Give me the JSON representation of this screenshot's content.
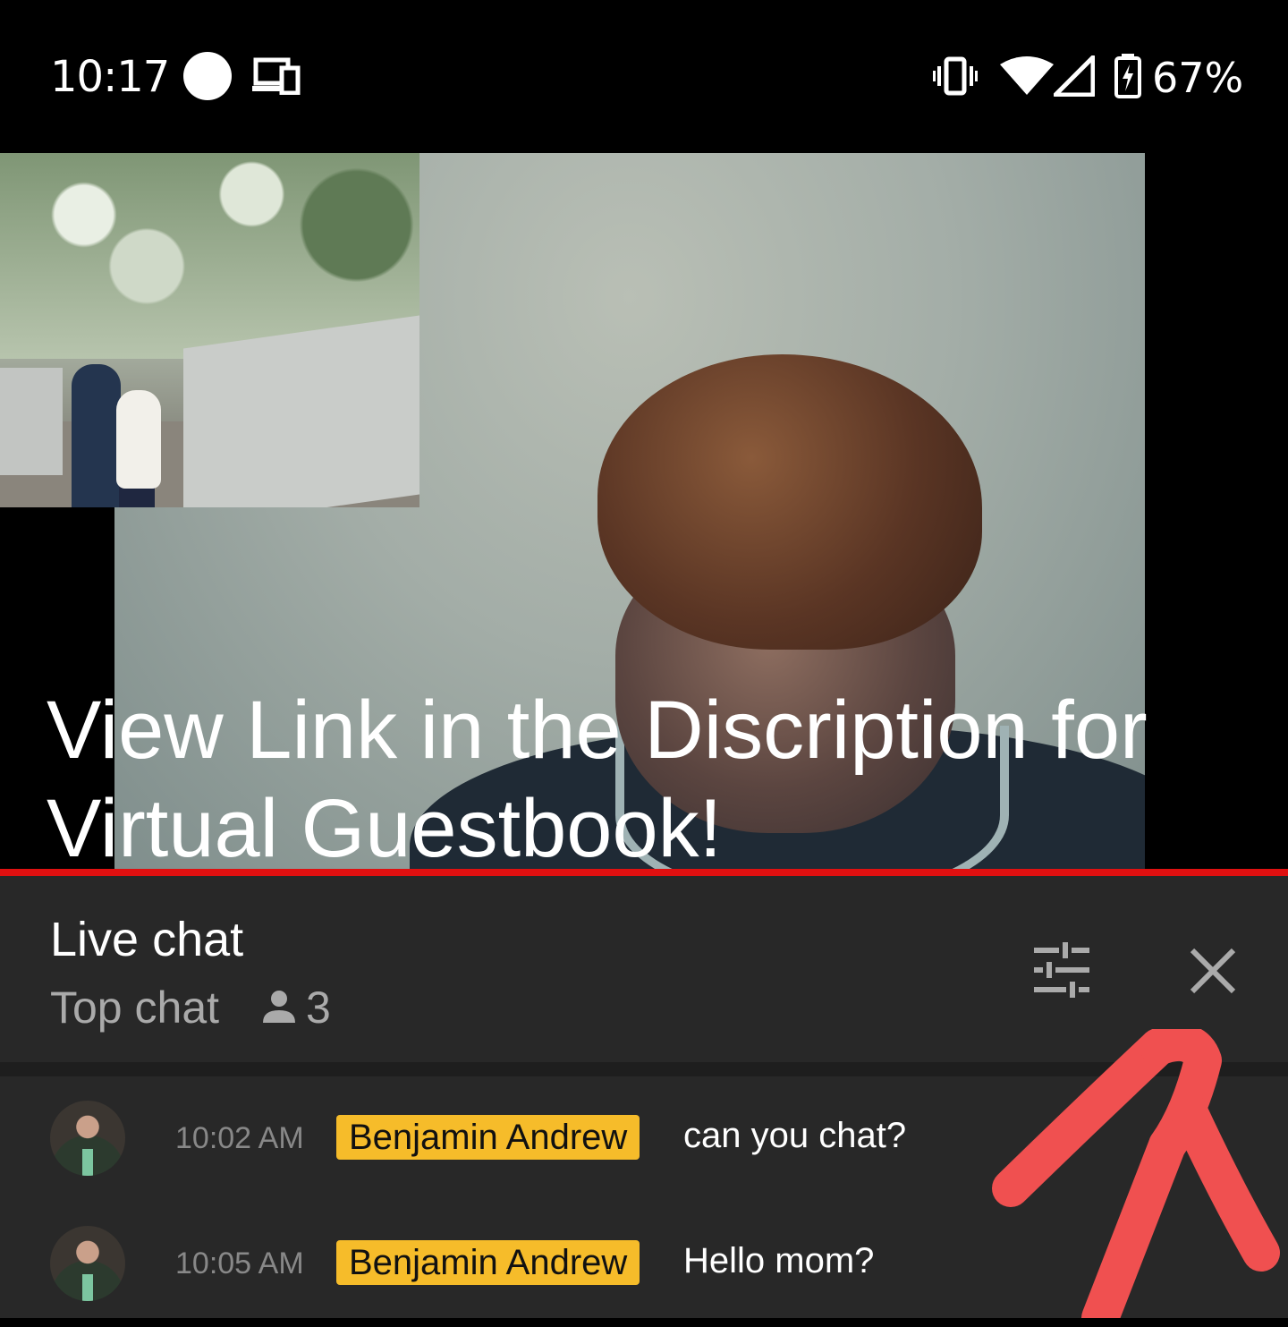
{
  "status_bar": {
    "time": "10:17",
    "battery_percent": "67%",
    "icons": [
      "recording-dot-icon",
      "cast-devices-icon",
      "vibrate-icon",
      "wifi-icon",
      "cell-signal-icon",
      "battery-charging-icon"
    ]
  },
  "video": {
    "caption": "View Link in the Discription for Virtual Guestbook!",
    "progress_color": "#e01010"
  },
  "live_chat": {
    "title": "Live chat",
    "mode": "Top chat",
    "viewer_count": "3",
    "icons": [
      "person-icon",
      "filter-sliders-icon",
      "close-icon"
    ],
    "messages": [
      {
        "time": "10:02 AM",
        "author": "Benjamin Andrew",
        "text": "can you chat?"
      },
      {
        "time": "10:05 AM",
        "author": "Benjamin Andrew",
        "text": "Hello mom?"
      }
    ]
  },
  "colors": {
    "chat_bg": "#282828",
    "author_badge": "#f6bc2a",
    "annotation_arrow": "#f05050"
  }
}
